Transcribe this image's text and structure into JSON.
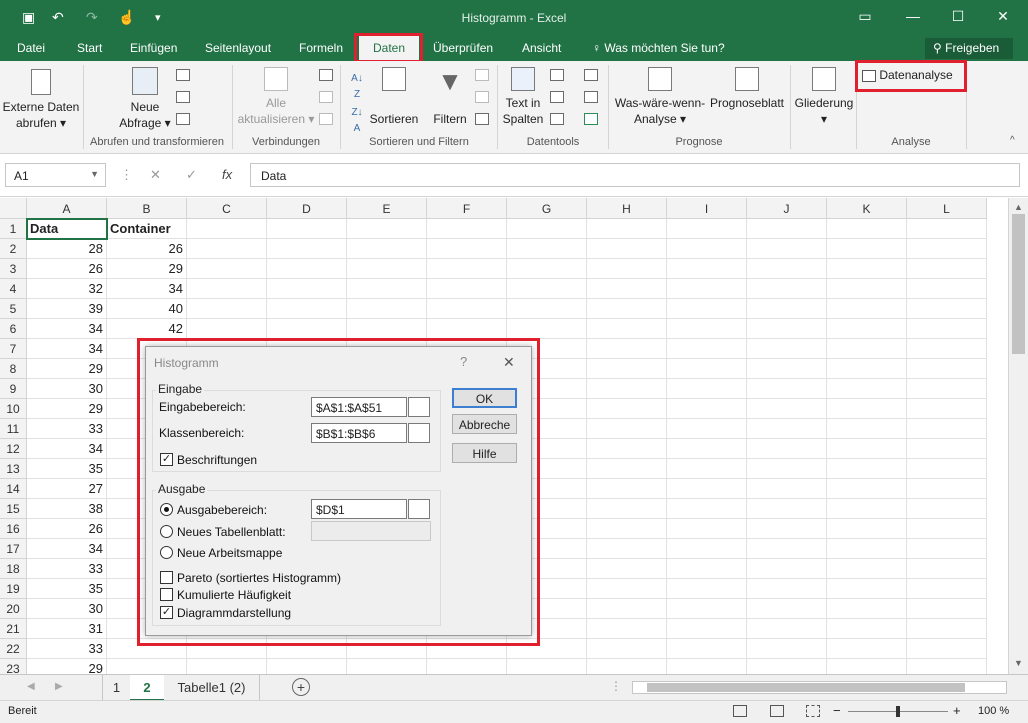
{
  "titlebar": {
    "title": "Histogramm - Excel",
    "min": "—",
    "max": "☐",
    "close": "✕"
  },
  "tabs": [
    "Datei",
    "Start",
    "Einfügen",
    "Seitenlayout",
    "Formeln",
    "Daten",
    "Überprüfen",
    "Ansicht"
  ],
  "tellme": "Was möchten Sie tun?",
  "share": "Freigeben",
  "ribbon": {
    "externe_1": "Externe Daten",
    "externe_2": "abrufen",
    "neue_1": "Neue",
    "neue_2": "Abfrage",
    "alle_1": "Alle",
    "alle_2": "aktualisieren",
    "sortieren": "Sortieren",
    "filtern": "Filtern",
    "text_1": "Text in",
    "text_2": "Spalten",
    "was_1": "Was-wäre-wenn-",
    "was_2": "Analyse",
    "prognose": "Prognoseblatt",
    "gliederung": "Gliederung",
    "datenanalyse": "Datenanalyse",
    "groups": {
      "abrufen": "Abrufen und transformieren",
      "verbindungen": "Verbindungen",
      "sortfilter": "Sortieren und Filtern",
      "datentools": "Datentools",
      "prognose": "Prognose",
      "analyse": "Analyse"
    }
  },
  "formula": {
    "namebox": "A1",
    "content": "Data",
    "fx": "fx"
  },
  "columns": [
    "A",
    "B",
    "C",
    "D",
    "E",
    "F",
    "G",
    "H",
    "I",
    "J",
    "K",
    "L"
  ],
  "rows": [
    [
      "Data",
      "Container"
    ],
    [
      "28",
      "26"
    ],
    [
      "26",
      "29"
    ],
    [
      "32",
      "34"
    ],
    [
      "39",
      "40"
    ],
    [
      "34",
      "42"
    ],
    [
      "34",
      ""
    ],
    [
      "29",
      ""
    ],
    [
      "30",
      ""
    ],
    [
      "29",
      ""
    ],
    [
      "33",
      ""
    ],
    [
      "34",
      ""
    ],
    [
      "35",
      ""
    ],
    [
      "27",
      ""
    ],
    [
      "38",
      ""
    ],
    [
      "26",
      ""
    ],
    [
      "34",
      ""
    ],
    [
      "33",
      ""
    ],
    [
      "35",
      ""
    ],
    [
      "30",
      ""
    ],
    [
      "31",
      ""
    ],
    [
      "33",
      ""
    ],
    [
      "29",
      ""
    ]
  ],
  "sheets": {
    "t1": "1",
    "t2": "2",
    "t3": "Tabelle1 (2)",
    "add": "+"
  },
  "status": {
    "ready": "Bereit",
    "zoom": "100 %"
  },
  "dialog": {
    "title": "Histogramm",
    "help": "?",
    "close": "✕",
    "eingabe": "Eingabe",
    "eingabebereich_label": "Eingabebereich:",
    "eingabebereich": "$A$1:$A$51",
    "klassenbereich_label": "Klassenbereich:",
    "klassenbereich": "$B$1:$B$6",
    "beschriftungen": "Beschriftungen",
    "ausgabe": "Ausgabe",
    "ausgabebereich_label": "Ausgabebereich:",
    "ausgabebereich": "$D$1",
    "neues_blatt": "Neues Tabellenblatt:",
    "neue_mappe": "Neue Arbeitsmappe",
    "pareto": "Pareto (sortiertes Histogramm)",
    "kumuliert": "Kumulierte Häufigkeit",
    "diagramm": "Diagrammdarstellung",
    "ok": "OK",
    "abbrechen": "Abbreche",
    "hilfe": "Hilfe",
    "checkmark": "✓"
  }
}
